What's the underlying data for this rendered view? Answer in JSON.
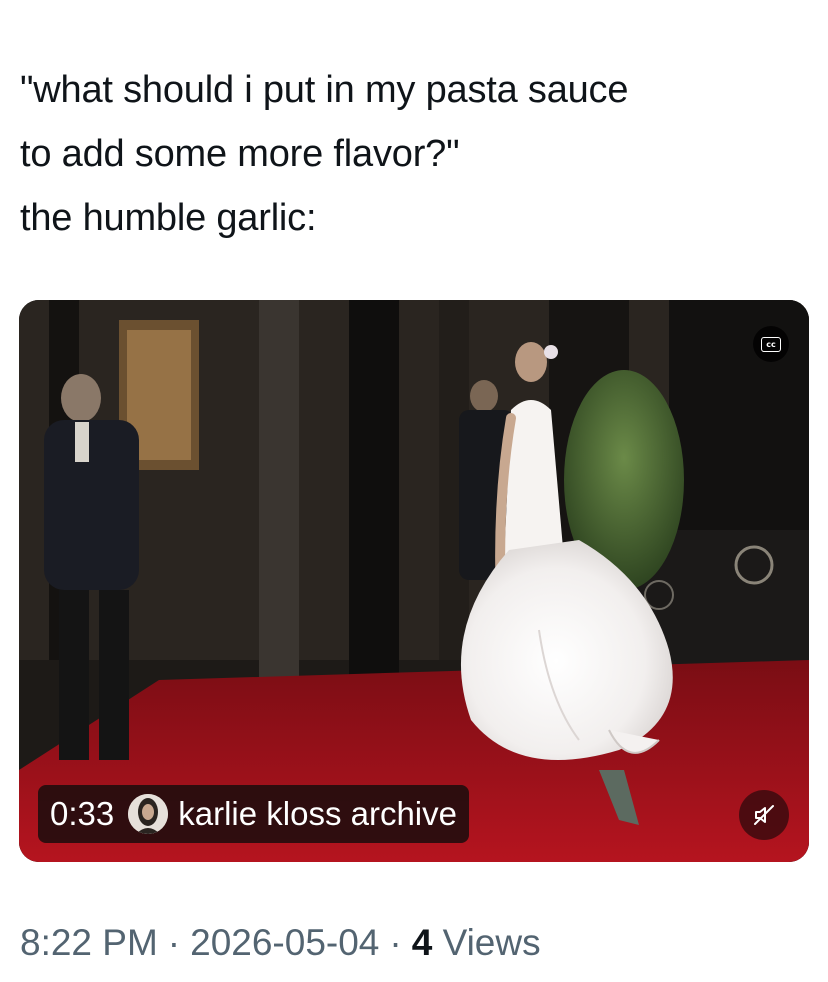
{
  "tweet": {
    "text_lines": [
      "\"what should i put in my pasta sauce",
      "to add some more flavor?\"",
      "the humble garlic:"
    ]
  },
  "video": {
    "duration": "0:33",
    "source_name": "karlie kloss archive",
    "cc_label": "cc",
    "icons": {
      "captions": "closed-captions-icon",
      "mute": "speaker-muted-icon",
      "avatar": "profile-avatar"
    }
  },
  "meta": {
    "time": "8:22 PM",
    "separator": "·",
    "date": "2026-05-04",
    "views_count": "4",
    "views_label": "Views"
  },
  "colors": {
    "text_primary": "#0f1419",
    "text_secondary": "#536471",
    "carpet": "#a3121c"
  }
}
